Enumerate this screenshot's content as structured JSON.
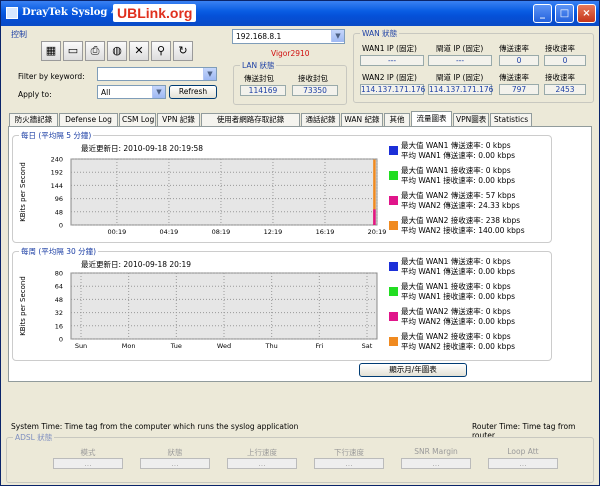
{
  "window": {
    "title": "DrayTek Syslog 4.2.2",
    "brand": "UBLink.org",
    "min": "_",
    "max": "□",
    "close": "×"
  },
  "control": {
    "title": "控制",
    "filter_label": "Filter by keyword:",
    "filter_value": "",
    "apply_label": "Apply to:",
    "apply_value": "All",
    "refresh": "Refresh"
  },
  "router": {
    "ip": "192.168.8.1",
    "model": "Vigor2910"
  },
  "lan": {
    "title": "LAN 狀態",
    "sent_h": "傳送封包",
    "recv_h": "接收封包",
    "sent": "114169",
    "recv": "73350"
  },
  "wan": {
    "title": "WAN 狀態",
    "wan1_fixed": "WAN1 IP (固定)",
    "gw_fixed": "閘道 IP (固定)",
    "tx_rate": "傳送速率",
    "rx_rate": "接收速率",
    "wan1_ip": "---",
    "wan1_gw": "---",
    "wan1_tx": "0",
    "wan1_rx": "0",
    "wan2_fixed": "WAN2 IP (固定)",
    "gw2_fixed": "閘道 IP (固定)",
    "tx_rate2": "傳送速率",
    "rx_rate2": "接收速率",
    "wan2_ip": "114.137.171.176",
    "wan2_gw": "114.137.171.176",
    "wan2_tx": "797",
    "wan2_rx": "2453"
  },
  "tabs": [
    "防火牆記錄",
    "Defense Log",
    "CSM Log",
    "VPN 記錄",
    "使用者網路存取記錄",
    "通話記錄",
    "WAN 紀錄",
    "其他",
    "流量圖表",
    "VPN圖表",
    "Statistics"
  ],
  "chart1": {
    "title": "每日 (平均隔 5 分鐘)",
    "updated": "最近更新日: 2010-09-18 20:19:58"
  },
  "chart2": {
    "title": "每周 (平均隔 30 分鐘)",
    "updated": "最近更新日: 2010-09-18 20:19"
  },
  "legend": [
    {
      "l1": "最大值 WAN1 傳送速率: 0 kbps",
      "l2": "平均 WAN1 傳送速率: 0.00 kbps",
      "color": "#1c2fd8"
    },
    {
      "l1": "最大值 WAN1 接收速率: 0 kbps",
      "l2": "平均 WAN1 接收速率: 0.00 kbps",
      "color": "#22dd22"
    },
    {
      "l1": "最大值 WAN2 傳送速率: 57 kbps",
      "l2": "平均 WAN2 傳送速率: 24.33 kbps",
      "color": "#e0158a"
    },
    {
      "l1": "最大值 WAN2 接收速率: 238 kbps",
      "l2": "平均 WAN2 接收速率: 140.00 kbps",
      "color": "#f08a20"
    }
  ],
  "legend2": [
    {
      "l1": "最大值 WAN1 傳送速率: 0 kbps",
      "l2": "平均 WAN1 傳送速率: 0.00 kbps",
      "color": "#1c2fd8"
    },
    {
      "l1": "最大值 WAN1 接收速率: 0 kbps",
      "l2": "平均 WAN1 接收速率: 0.00 kbps",
      "color": "#22dd22"
    },
    {
      "l1": "最大值 WAN2 傳送速率: 0 kbps",
      "l2": "平均 WAN2 傳送速率: 0.00 kbps",
      "color": "#e0158a"
    },
    {
      "l1": "最大值 WAN2 接收速率: 0 kbps",
      "l2": "平均 WAN2 接收速率: 0.00 kbps",
      "color": "#f08a20"
    }
  ],
  "show_btn": "顯示月/年圖表",
  "footer": {
    "system_time": "System Time: Time tag from the computer which runs the syslog application",
    "router_time": "Router Time: Time tag from router"
  },
  "adsl": {
    "title": "ADSL 狀態",
    "cols": [
      "模式",
      "狀態",
      "上行速度",
      "下行速度",
      "SNR Margin",
      "Loop Att"
    ],
    "val": "..."
  },
  "chart_data": [
    {
      "type": "line",
      "title": "每日 (平均隔 5 分鐘)",
      "ylabel": "KBits per Second",
      "ylim": [
        0,
        240
      ],
      "yticks": [
        0,
        48,
        96,
        144,
        192,
        240
      ],
      "xticks": [
        "00:19",
        "04:19",
        "08:19",
        "12:19",
        "16:19",
        "20:19"
      ],
      "series": [
        {
          "name": "WAN2 接收速率",
          "color": "#f08a20",
          "values": [
            [
              20.1,
              238
            ],
            [
              20.3,
              0
            ]
          ]
        },
        {
          "name": "WAN2 傳送速率",
          "color": "#e0158a",
          "values": [
            [
              20.1,
              57
            ],
            [
              20.3,
              0
            ]
          ]
        }
      ]
    },
    {
      "type": "line",
      "title": "每周 (平均隔 30 分鐘)",
      "ylabel": "KBits per Second",
      "ylim": [
        0,
        80
      ],
      "yticks": [
        0,
        16,
        32,
        48,
        64,
        80
      ],
      "xticks": [
        "Sun",
        "Mon",
        "Tue",
        "Wed",
        "Thu",
        "Fri",
        "Sat"
      ],
      "series": []
    }
  ]
}
